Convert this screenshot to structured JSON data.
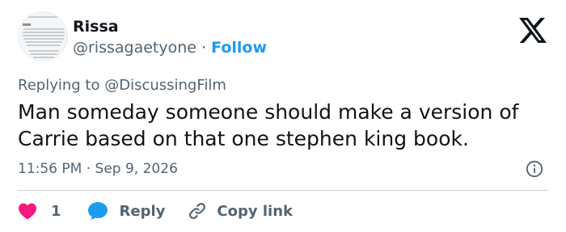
{
  "author": {
    "name": "Rissa",
    "handle": "@rissagaetyone",
    "separator": "·",
    "follow_label": "Follow"
  },
  "reply_context": {
    "prefix": "Replying to",
    "mention": "@DiscussingFilm"
  },
  "tweet": {
    "text": "Man someday someone should make a version of Carrie based on that one stephen king book.",
    "time": "11:56 PM",
    "separator": "·",
    "date": "Sep 9, 2026"
  },
  "actions": {
    "like_count": "1",
    "reply_label": "Reply",
    "copy_link_label": "Copy link"
  },
  "icons": {
    "brand": "x-logo-icon",
    "info": "info-icon",
    "like": "heart-icon",
    "reply": "speech-bubble-icon",
    "copy": "link-icon"
  },
  "colors": {
    "follow_link": "#1d9bf0",
    "like_heart": "#f91880",
    "reply_bubble": "#1d9bf0",
    "secondary_text": "#536471"
  }
}
